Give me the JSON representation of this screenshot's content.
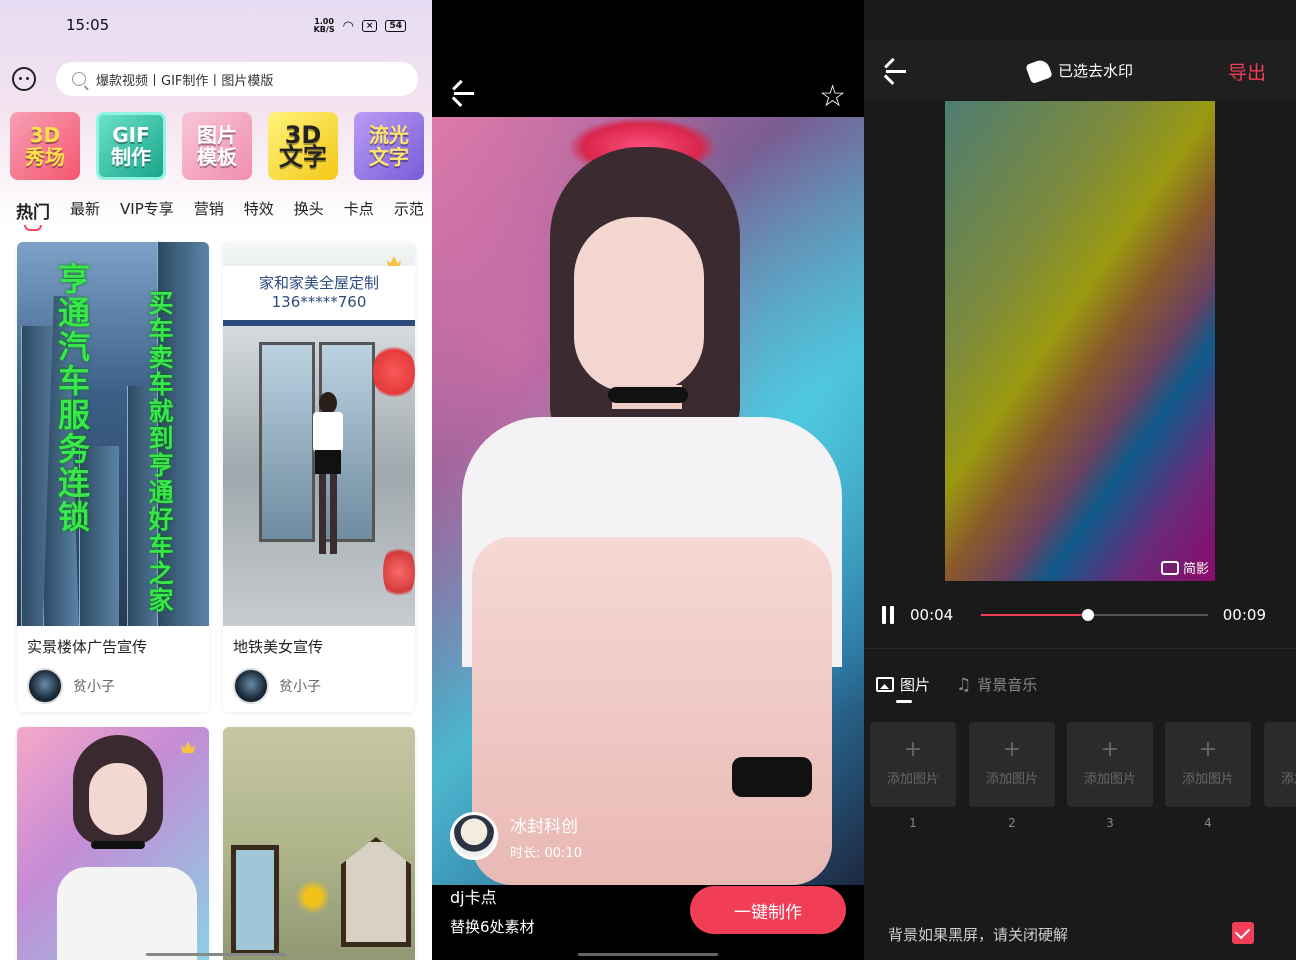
{
  "panel_home": {
    "status": {
      "time": "15:05",
      "speed": "1.00\nKB/S",
      "battery": "54"
    },
    "search": {
      "placeholder": "爆款视频丨GIF制作丨图片模版"
    },
    "categories": [
      {
        "label": "3D\n秀场"
      },
      {
        "label": "GIF\n制作"
      },
      {
        "label": "图片\n模板"
      },
      {
        "label": "3D\n文字"
      },
      {
        "label": "流光\n文字"
      }
    ],
    "tabs": [
      "热门",
      "最新",
      "VIP专享",
      "营销",
      "特效",
      "换头",
      "卡点",
      "示范"
    ],
    "cards": [
      {
        "title": "实景楼体广告宣传",
        "author": "贫小子",
        "overlay_left": "亨通汽车服务连锁",
        "overlay_right": "买车卖车就到亨通好车之家"
      },
      {
        "title": "地铁美女宣传",
        "author": "贫小子",
        "banner_line1": "家和家美全屋定制",
        "banner_line2": "136*****760"
      },
      {
        "title": "",
        "author": ""
      },
      {
        "title": "",
        "author": ""
      }
    ]
  },
  "panel_detail": {
    "creator": {
      "name": "冰封科创",
      "duration": "时长: 00:10"
    },
    "template_title": "dj卡点",
    "template_sub": "替换6处素材",
    "make_button": "一键制作"
  },
  "panel_editor": {
    "watermark_label": "已选去水印",
    "export_label": "导出",
    "preview_watermark": "简影",
    "playback": {
      "current": "00:04",
      "total": "00:09",
      "progress": 0.47
    },
    "tabs": [
      {
        "label": "图片"
      },
      {
        "label": "背景音乐"
      }
    ],
    "slots": [
      {
        "label": "添加图片",
        "num": "1"
      },
      {
        "label": "添加图片",
        "num": "2"
      },
      {
        "label": "添加图片",
        "num": "3"
      },
      {
        "label": "添加图片",
        "num": "4"
      },
      {
        "label": "添加图片",
        "num": ""
      }
    ],
    "tip": "背景如果黑屏，请关闭硬解",
    "accent": "#f23d57"
  }
}
